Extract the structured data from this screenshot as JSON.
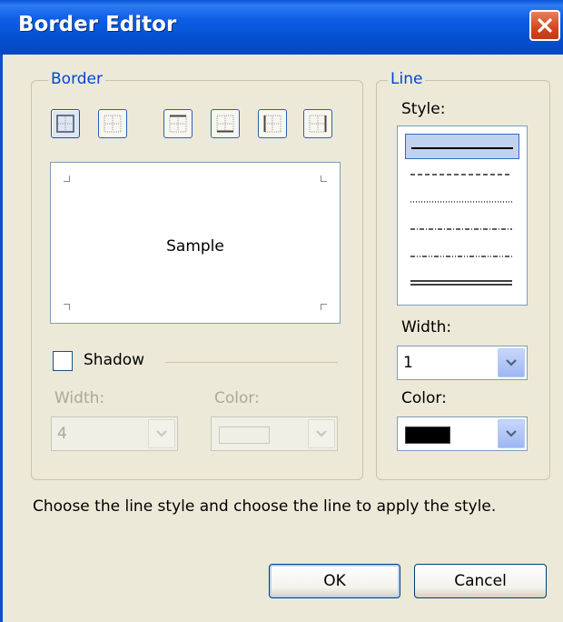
{
  "window": {
    "title": "Border Editor"
  },
  "border_group": {
    "legend": "Border",
    "preview_text": "Sample",
    "shadow_label": "Shadow",
    "width_label": "Width:",
    "width_value": "4",
    "color_label": "Color:"
  },
  "line_group": {
    "legend": "Line",
    "style_label": "Style:",
    "styles": [
      "solid",
      "dashed",
      "dotted",
      "dash-dot",
      "dash-dot-dot",
      "double"
    ],
    "selected_style": "solid",
    "width_label": "Width:",
    "width_value": "1",
    "color_label": "Color:",
    "color_value": "#000000"
  },
  "hint": "Choose the line style and choose the line to apply the style.",
  "buttons": {
    "ok": "OK",
    "cancel": "Cancel"
  }
}
